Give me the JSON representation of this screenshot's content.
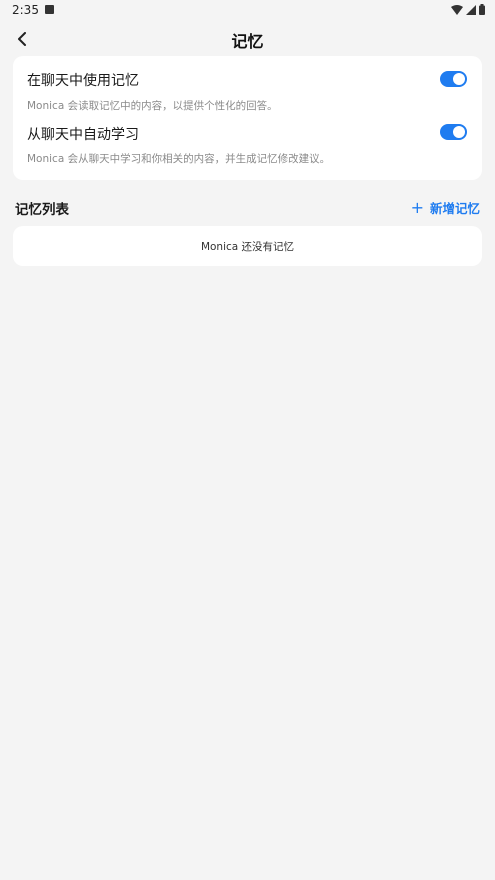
{
  "status_bar": {
    "time": "2:35"
  },
  "header": {
    "title": "记忆"
  },
  "settings": [
    {
      "title": "在聊天中使用记忆",
      "description": "Monica 会读取记忆中的内容，以提供个性化的回答。",
      "enabled": true
    },
    {
      "title": "从聊天中自动学习",
      "description": "Monica 会从聊天中学习和你相关的内容，并生成记忆修改建议。",
      "enabled": true
    }
  ],
  "memory_list": {
    "title": "记忆列表",
    "add_label": "新增记忆",
    "add_icon": "+",
    "empty_text": "Monica 还没有记忆"
  },
  "colors": {
    "accent": "#1f7cf0",
    "background": "#f4f4f4"
  }
}
